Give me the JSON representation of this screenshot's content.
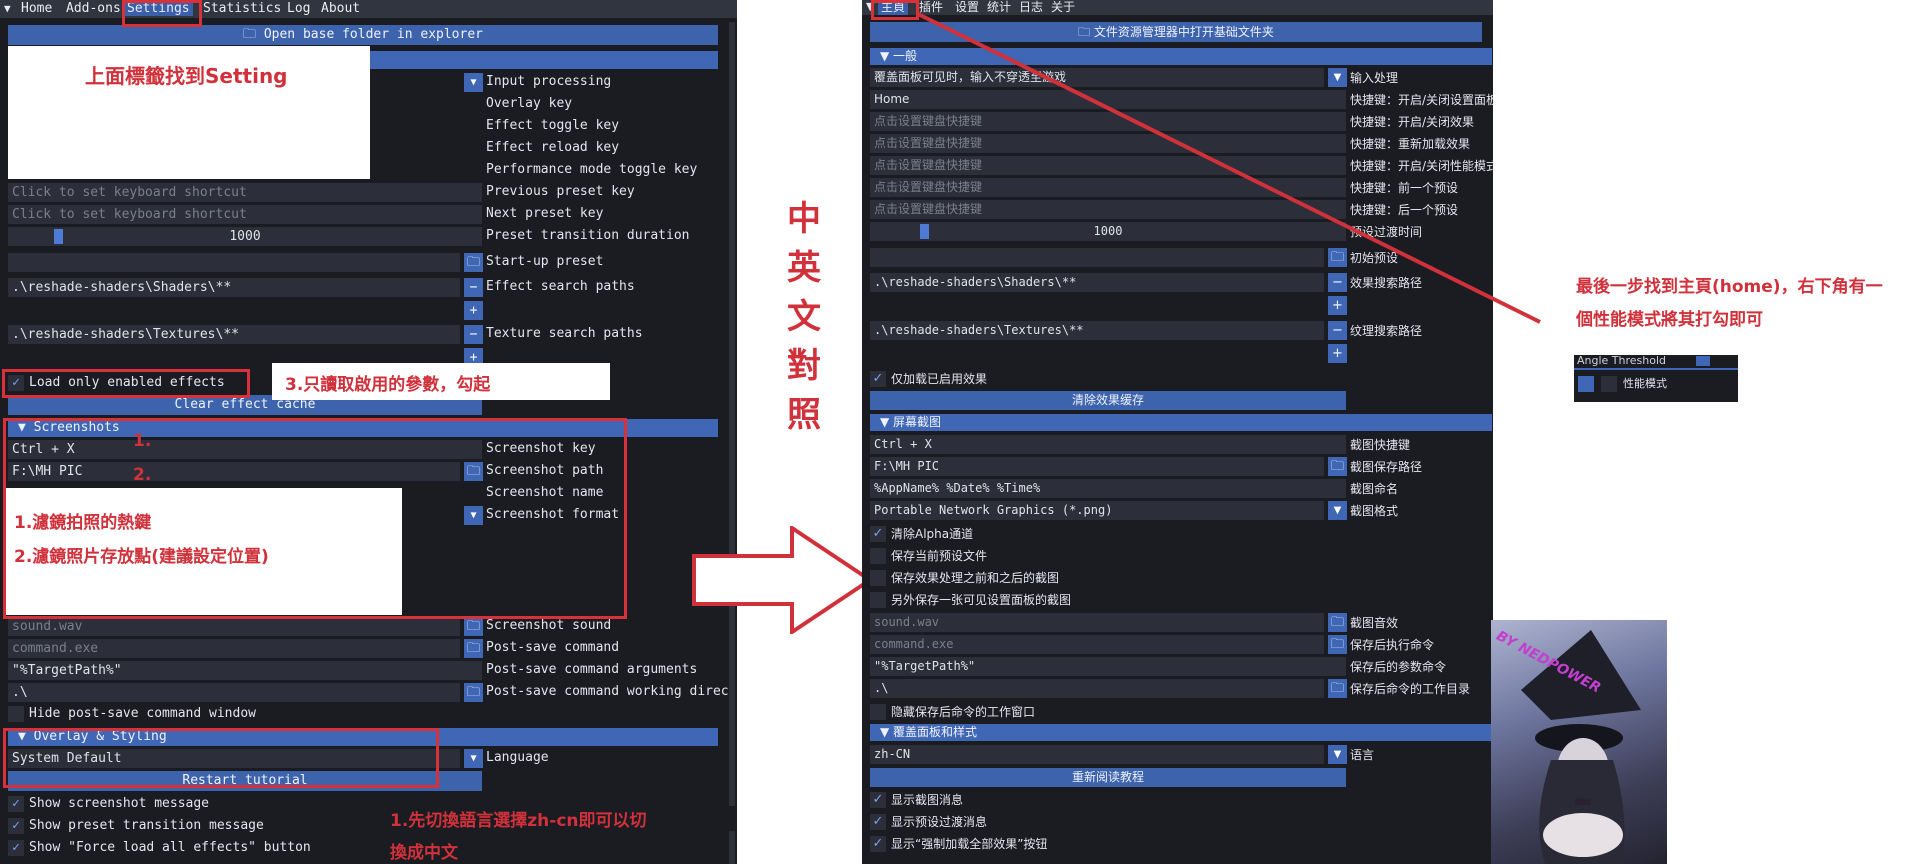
{
  "left": {
    "tabs": [
      "Home",
      "Add-ons",
      "Settings",
      "Statistics",
      "Log",
      "About"
    ],
    "open_folder": "Open base folder in explorer",
    "rows": {
      "input_processing": "Input processing",
      "overlay_key": "Overlay key",
      "effect_toggle_key": "Effect toggle key",
      "effect_reload_key": "Effect reload key",
      "perf_toggle_key": "Performance mode toggle key",
      "prev_preset_key": "Previous preset key",
      "next_preset_key": "Next preset key",
      "preset_transition": "Preset transition duration",
      "startup_preset": "Start-up preset",
      "effect_search_paths": "Effect search paths",
      "texture_search_paths": "Texture search paths"
    },
    "shortcut_placeholder": "Click to set keyboard shortcut",
    "transition_value": "1000",
    "shaders_path": ".\\reshade-shaders\\Shaders\\**",
    "textures_path": ".\\reshade-shaders\\Textures\\**",
    "load_only_enabled": "Load only enabled effects",
    "clear_cache": "Clear effect cache",
    "screenshots_header": "Screenshots",
    "screenshot_key_value": "Ctrl + X",
    "screenshot_key": "Screenshot key",
    "screenshot_path_value": "F:\\MH PIC",
    "screenshot_path": "Screenshot path",
    "screenshot_name": "Screenshot name",
    "screenshot_format": "Screenshot format",
    "sound_value": "sound.wav",
    "screenshot_sound": "Screenshot sound",
    "command_value": "command.exe",
    "post_save_command": "Post-save command",
    "args_value": "\"%TargetPath%\"",
    "post_save_args": "Post-save command arguments",
    "workdir_value": ".\\",
    "post_save_workdir": "Post-save command working direc",
    "hide_window": "Hide post-save command window",
    "overlay_header": "Overlay & Styling",
    "language_value": "System Default",
    "language": "Language",
    "restart_tutorial": "Restart tutorial",
    "show_screenshot_msg": "Show screenshot message",
    "show_preset_msg": "Show preset transition message",
    "show_force_load": "Show \"Force load all effects\" button"
  },
  "right": {
    "tabs": [
      "主頁",
      "插件",
      "设置",
      "统计",
      "日志",
      "关于"
    ],
    "open_folder": "文件资源管理器中打开基础文件夹",
    "general_header": "一般",
    "overlay_input": "覆盖面板可见时，输入不穿透至游戏",
    "input_processing": "输入处理",
    "home_value": "Home",
    "overlay_key": "快捷键：开启/关闭设置面板",
    "shortcut_placeholder": "点击设置键盘快捷键",
    "toggle_effects": "快捷键：开启/关闭效果",
    "reload_effects": "快捷键：重新加载效果",
    "perf_mode": "快捷键：开启/关闭性能模式",
    "prev_preset": "快捷键：前一个预设",
    "next_preset": "快捷键：后一个预设",
    "transition_value": "1000",
    "transition_label": "预设过渡时间",
    "startup_preset": "初始预设",
    "shaders_path": ".\\reshade-shaders\\Shaders\\**",
    "effect_search_paths": "效果搜索路径",
    "textures_path": ".\\reshade-shaders\\Textures\\**",
    "texture_search_paths": "纹理搜索路径",
    "load_only_enabled": "仅加载已启用效果",
    "clear_cache": "清除效果缓存",
    "screenshot_header": "屏幕截图",
    "screenshot_key_value": "Ctrl + X",
    "screenshot_key": "截图快捷键",
    "screenshot_path_value": "F:\\MH PIC",
    "screenshot_path": "截图保存路径",
    "name_value": "%AppName% %Date% %Time%",
    "screenshot_name": "截图命名",
    "format_value": "Portable Network Graphics (*.png)",
    "screenshot_format": "截图格式",
    "clear_alpha": "清除Alpha通道",
    "save_preset": "保存当前预设文件",
    "save_before_after": "保存效果处理之前和之后的截图",
    "save_overlay": "另外保存一张可见设置面板的截图",
    "sound_value": "sound.wav",
    "screenshot_sound": "截图音效",
    "command_value": "command.exe",
    "post_save_command": "保存后执行命令",
    "args_value": "\"%TargetPath%\"",
    "post_save_args": "保存后的参数命令",
    "workdir_value": ".\\",
    "post_save_workdir": "保存后命令的工作目录",
    "hide_window": "隐藏保存后命令的工作窗口",
    "overlay_header": "覆盖面板和样式",
    "language_value": "zh-CN",
    "language": "语言",
    "restart_tutorial": "重新阅读教程",
    "show_screenshot_msg": "显示截图消息",
    "show_preset_msg": "显示预设过渡消息",
    "show_force_load": "显示“强制加载全部效果”按钮"
  },
  "annotations": {
    "find_setting": "上面標籤找到Setting",
    "load_enabled_tip": "3.只讀取啟用的參數，勾起",
    "num1": "1.",
    "num2": "2.",
    "hotkey_tip": "1.濾鏡拍照的熱鍵",
    "path_tip": "2.濾鏡照片存放點(建議設定位置)",
    "lang_tip_1": "1.先切換語言選擇zh-cn即可以切",
    "lang_tip_2": "換成中文",
    "compare": [
      "中",
      "英",
      "文",
      "對",
      "照"
    ],
    "final_tip_1": "最後一步找到主頁(home)，右下角有一",
    "final_tip_2": "個性能模式將其打勾即可",
    "angle_threshold": "Angle Threshold",
    "perf_mode_label": "性能模式",
    "signature": "BY NEDPOWER"
  },
  "colors": {
    "accent": "#3f67b5",
    "annotation_red": "#d0313a",
    "panel_bg": "#1b1c22"
  },
  "icons": {
    "folder": "folder-icon",
    "collapse": "triangle-down-icon",
    "dropdown": "dropdown-arrow-icon",
    "add": "plus-icon",
    "remove": "minus-icon",
    "check": "checkmark-icon",
    "arrow": "right-arrow-icon"
  }
}
